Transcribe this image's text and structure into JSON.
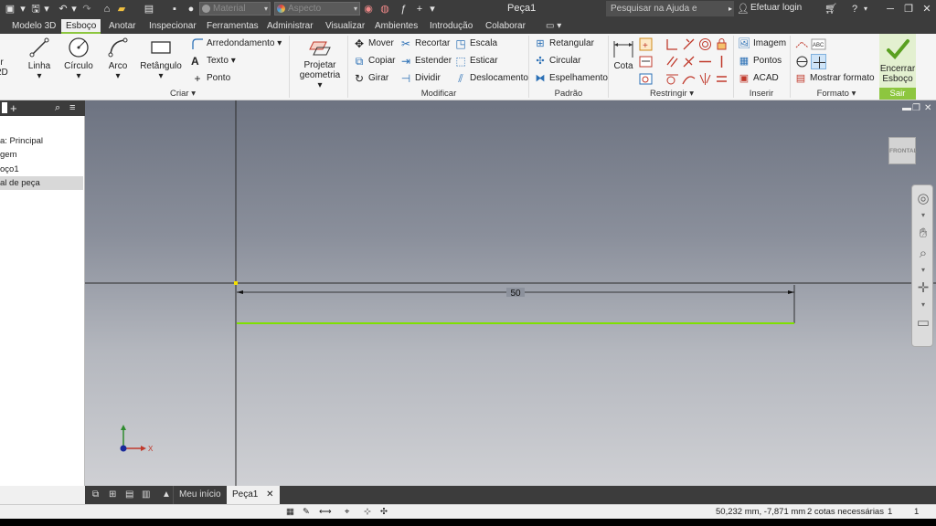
{
  "window": {
    "title": "Peça1",
    "help_search_placeholder": "Pesquisar na Ajuda e comandos",
    "login_label": "Efetuar login",
    "material_value": "Material",
    "appearance_value": "Aspecto",
    "material_color": "#8a8a8a",
    "appearance_color": "#d2a24a"
  },
  "menu_tabs": [
    "Modelo 3D",
    "Esboço",
    "Anotar",
    "Inspecionar",
    "Ferramentas",
    "Administrar",
    "Visualizar",
    "Ambientes",
    "Introdução",
    "Colaborar"
  ],
  "ribbon": {
    "create": {
      "title": "Criar",
      "cut_label": "r",
      "cut_label2": "2D",
      "line": "Linha",
      "circle": "Círculo",
      "arc": "Arco",
      "rectangle": "Retângulo",
      "fillet": "Arredondamento",
      "text": "Texto",
      "point": "Ponto",
      "project_1": "Projetar",
      "project_2": "geometria"
    },
    "modify": {
      "title": "Modificar",
      "move": "Mover",
      "trim": "Recortar",
      "scale": "Escala",
      "copy": "Copiar",
      "extend": "Estender",
      "stretch": "Esticar",
      "rotate": "Girar",
      "split": "Dividir",
      "offset": "Deslocamento"
    },
    "pattern": {
      "title": "Padrão",
      "rectangular": "Retangular",
      "circular": "Circular",
      "mirror": "Espelhamento"
    },
    "constrain": {
      "title": "Restringir",
      "dimension": "Cota"
    },
    "insert": {
      "title": "Inserir",
      "image": "Imagem",
      "points": "Pontos",
      "acad": "ACAD"
    },
    "format": {
      "title": "Formato",
      "show_format": "Mostrar formato"
    },
    "exit": {
      "finish_1": "Encerrar",
      "finish_2": "Esboço",
      "title": "Sair"
    }
  },
  "browser": {
    "rows": [
      "a: Principal",
      "gem",
      "oço1",
      "al de peça"
    ]
  },
  "viewport": {
    "viewcube_label": "FRONTAL",
    "dimension_value": "50",
    "axis_x_label": "X",
    "sketch_line_color": "#7fe000"
  },
  "doc_tabs": {
    "home": "Meu início",
    "part": "Peça1"
  },
  "status": {
    "coords": "50,232 mm, -7,871 mm",
    "dims_needed": "2 cotas necessárias",
    "count_1": "1",
    "count_2": "1"
  }
}
